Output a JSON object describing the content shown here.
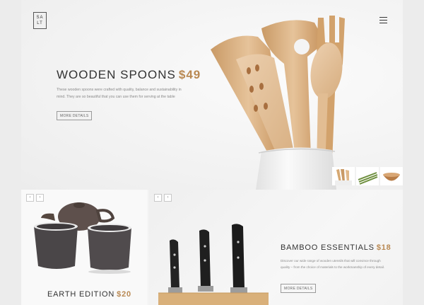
{
  "brand": {
    "logo_line1": "SA",
    "logo_line2": "LT"
  },
  "header": {
    "menu_icon": "hamburger-icon"
  },
  "hero": {
    "title": "WOODEN SPOONS",
    "price": "$49",
    "description": "These wooden spoons were crafted with quality, balance and sustainability in mind. They are so beautiful that you can use them for serving at the table",
    "button_label": "MORE DETAILS",
    "thumbnails": [
      "wooden-utensils-thumb",
      "asparagus-thumb",
      "wooden-bowl-thumb"
    ]
  },
  "earth": {
    "prev_arrow": "‹",
    "next_arrow": "›",
    "title": "EARTH EDITION",
    "price": "$20"
  },
  "bamboo": {
    "prev_arrow": "‹",
    "next_arrow": "›",
    "title": "BAMBOO ESSENTIALS",
    "price": "$18",
    "description": "Discover our wide range of wooden utensils that will convince through quality – from the choice of materials to the workmanship of every detail.",
    "button_label": "MORE DETAILS"
  },
  "colors": {
    "accent": "#b98953",
    "text": "#333333",
    "muted": "#8a8a8a",
    "background": "#ececec"
  }
}
